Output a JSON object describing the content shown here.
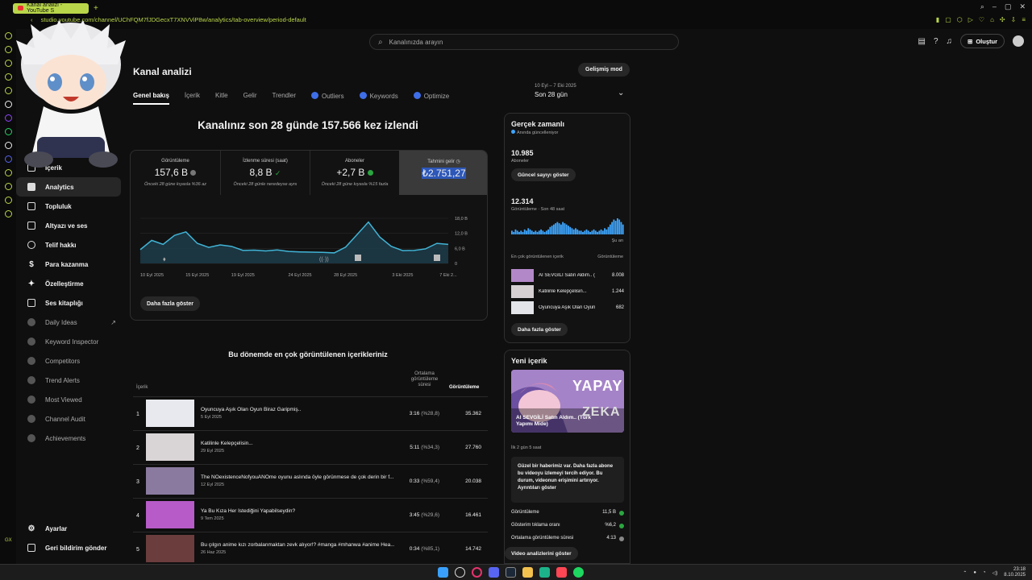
{
  "browser": {
    "tab_title": "Kanal analizi - YouTube S",
    "url": "studio.youtube.com/channel/UChFQM7fJDGecxT7XNVViP8w/analytics/tab-overview/period-default"
  },
  "header": {
    "search_placeholder": "Kanalınızda arayın",
    "create_label": "Oluştur"
  },
  "sidebar": {
    "items": [
      {
        "label": "İçerik"
      },
      {
        "label": "Analytics"
      },
      {
        "label": "Topluluk"
      },
      {
        "label": "Altyazı ve ses"
      },
      {
        "label": "Telif hakkı"
      },
      {
        "label": "Para kazanma"
      },
      {
        "label": "Özelleştirme"
      },
      {
        "label": "Ses kitaplığı"
      },
      {
        "label": "Daily Ideas"
      },
      {
        "label": "Keyword Inspector"
      },
      {
        "label": "Competitors"
      },
      {
        "label": "Trend Alerts"
      },
      {
        "label": "Most Viewed"
      },
      {
        "label": "Channel Audit"
      },
      {
        "label": "Achievements"
      }
    ],
    "settings_label": "Ayarlar",
    "feedback_label": "Geri bildirim gönder",
    "gx_label": "GX"
  },
  "main": {
    "title": "Kanal analizi",
    "advanced_mode": "Gelişmiş mod",
    "tabs": [
      "Genel bakış",
      "İçerik",
      "Kitle",
      "Gelir",
      "Trendler",
      "Outliers",
      "Keywords",
      "Optimize"
    ],
    "period_range": "10 Eyl – 7 Eki 2025",
    "period_label": "Son 28 gün",
    "headline": "Kanalınız son 28 günde 157.566 kez izlendi",
    "metrics": [
      {
        "label": "Görüntüleme",
        "value": "157,6 B",
        "sub": "Önceki 28 güne kıyasla %36 az"
      },
      {
        "label": "İzlenme süresi (saat)",
        "value": "8,8 B",
        "sub": "Önceki 28 günle neredeyse aynı"
      },
      {
        "label": "Aboneler",
        "value": "+2,7 B",
        "sub": "Önceki 28 güne kıyasla %15 fazla"
      },
      {
        "label": "Tahmini gelir",
        "value": "₺2.751,27",
        "sub": ""
      }
    ],
    "show_more": "Daha fazla göster",
    "top_content_title": "Bu dönemde en çok görüntülenen içerikleriniz",
    "top_content_headers": {
      "content": "İçerik",
      "avg_duration": "Ortalama görüntüleme süresi",
      "views": "Görüntüleme"
    },
    "top_content": [
      {
        "rank": "1",
        "title": "Oyuncuya Aşık Olan Oyun Biraz Garipmiş..",
        "date": "5 Eyl 2025",
        "duration": "3:16",
        "pct": "(%28,8)",
        "views": "35.362"
      },
      {
        "rank": "2",
        "title": "Katilinle Kelepçelisin...",
        "date": "29 Eyl 2025",
        "duration": "5:11",
        "pct": "(%34,3)",
        "views": "27.760"
      },
      {
        "rank": "3",
        "title": "The NOexistenceNofyouANOme oyunu aslında öyle görünmese de çok derin bir f...",
        "date": "12 Eyl 2025",
        "duration": "0:33",
        "pct": "(%59,4)",
        "views": "20.038"
      },
      {
        "rank": "4",
        "title": "Ya Bu Kıza Her İstediğini Yapabilseydin?",
        "date": "9 Tem 2025",
        "duration": "3:45",
        "pct": "(%29,6)",
        "views": "16.461"
      },
      {
        "rank": "5",
        "title": "Bu çılgın anime kızı zorbalanmaktan zevk alıyor!? #manga #mhanwa #anime Hea...",
        "date": "26 Haz 2025",
        "duration": "0:34",
        "pct": "(%85,1)",
        "views": "14.742"
      }
    ]
  },
  "chart_data": {
    "type": "line",
    "x": [
      "10 Eyl 2025",
      "11",
      "12",
      "13",
      "14",
      "15 Eyl 2025",
      "16",
      "17",
      "18",
      "19 Eyl 2025",
      "20",
      "21",
      "22",
      "23",
      "24 Eyl 2025",
      "25",
      "26",
      "27",
      "28 Eyl 2025",
      "29",
      "30",
      "1 Eki",
      "2",
      "3 Eki 2025",
      "4",
      "5",
      "6",
      "7 Eki 2..."
    ],
    "x_tick_labels": [
      "10 Eyl 2025",
      "15 Eyl 2025",
      "19 Eyl 2025",
      "24 Eyl 2025",
      "28 Eyl 2025",
      "3 Eki 2025",
      "7 Eki 2..."
    ],
    "series": [
      {
        "values": [
          5.5,
          9.2,
          7.6,
          11.2,
          12.6,
          8.0,
          6.4,
          7.4,
          6.8,
          5.2,
          5.3,
          5.0,
          5.4,
          4.8,
          4.6,
          4.5,
          4.4,
          4.2,
          6.5,
          11.5,
          16.5,
          10.5,
          6.8,
          5.1,
          5.2,
          5.8,
          8.0,
          7.6
        ]
      }
    ],
    "y_ticks": [
      "0",
      "6,0 B",
      "12,0 B",
      "18,0 B"
    ],
    "ylim": [
      0,
      18
    ]
  },
  "realtime": {
    "title": "Gerçek zamanlı",
    "subtitle": "Anında güncelleniyor",
    "subscribers": "10.985",
    "subscribers_label": "Aboneler",
    "show_count_btn": "Güncel sayıyı göster",
    "views": "12.314",
    "views_label": "Görüntüleme · Son 48 saat",
    "now_label": "Şu an",
    "top_header": "En çok görüntülenen içerik",
    "top_header_right": "Görüntüleme",
    "bars": [
      3,
      2,
      4,
      3,
      2,
      3,
      2,
      4,
      3,
      5,
      4,
      3,
      2,
      3,
      2,
      3,
      4,
      3,
      2,
      3,
      4,
      6,
      7,
      8,
      9,
      10,
      9,
      8,
      10,
      9,
      8,
      7,
      6,
      5,
      4,
      5,
      4,
      3,
      3,
      2,
      3,
      4,
      3,
      2,
      3,
      4,
      3,
      2,
      3,
      4,
      3,
      5,
      4,
      6,
      8,
      10,
      12,
      11,
      13,
      12,
      10,
      8
    ],
    "top_items": [
      {
        "title": "AI SEVGİLİ Satın Aldım.. (...",
        "views": "8.008"
      },
      {
        "title": "Katilinle Kelepçelisin...",
        "views": "1.244"
      },
      {
        "title": "Oyuncuya Aşık Olan Oyun ...",
        "views": "682"
      }
    ],
    "more_btn": "Daha fazla göster"
  },
  "new_content": {
    "title": "Yeni içerik",
    "thumb_text": "YAPAY",
    "thumb_text2": "ZEKA",
    "video_title": "AI SEVGİLİ Satın Aldım.. (Türk Yapımı Mide)",
    "ago": "İlk 2 gün 5 saat",
    "message": "Güzel bir haberimiz var. Daha fazla abone bu videoyu izlemeyi tercih ediyor. Bu durum, videonun erişimini artırıyor.",
    "message_link": "Ayrıntıları göster",
    "stats": [
      {
        "label": "Görüntüleme",
        "value": "11,5 B"
      },
      {
        "label": "Gösterim tıklama oranı",
        "value": "%6,2"
      },
      {
        "label": "Ortalama görüntüleme süresi",
        "value": "4:13"
      }
    ],
    "analytics_btn": "Video analizlerini göster"
  },
  "taskbar": {
    "time": "23:18",
    "date": "8.10.2025"
  }
}
